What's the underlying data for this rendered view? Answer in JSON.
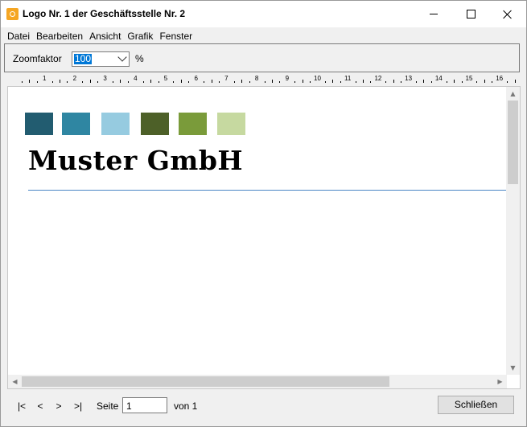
{
  "window": {
    "title": "Logo Nr. 1 der Geschäftsstelle Nr. 2"
  },
  "menu": {
    "items": [
      "Datei",
      "Bearbeiten",
      "Ansicht",
      "Grafik",
      "Fenster"
    ]
  },
  "toolbar": {
    "zoom_label": "Zoomfaktor",
    "zoom_value": "100",
    "zoom_unit": "%"
  },
  "ruler": {
    "numbers": [
      "1",
      "2",
      "3",
      "4",
      "5",
      "6",
      "7",
      "8",
      "9",
      "10",
      "11",
      "12",
      "13",
      "14",
      "15",
      "16"
    ]
  },
  "document": {
    "swatch_colors": [
      "#225c70",
      "#2f86a2",
      "#96cbe0",
      "#4d6028",
      "#7a9b3a",
      "#c6d9a0"
    ],
    "company_name": "Muster GmbH",
    "rule_color": "#4a86c5"
  },
  "footer": {
    "nav_first": "|<",
    "nav_prev": "<",
    "nav_next": ">",
    "nav_last": ">|",
    "page_label": "Seite",
    "page_value": "1",
    "page_total": "von 1",
    "close_label": "Schließen"
  }
}
